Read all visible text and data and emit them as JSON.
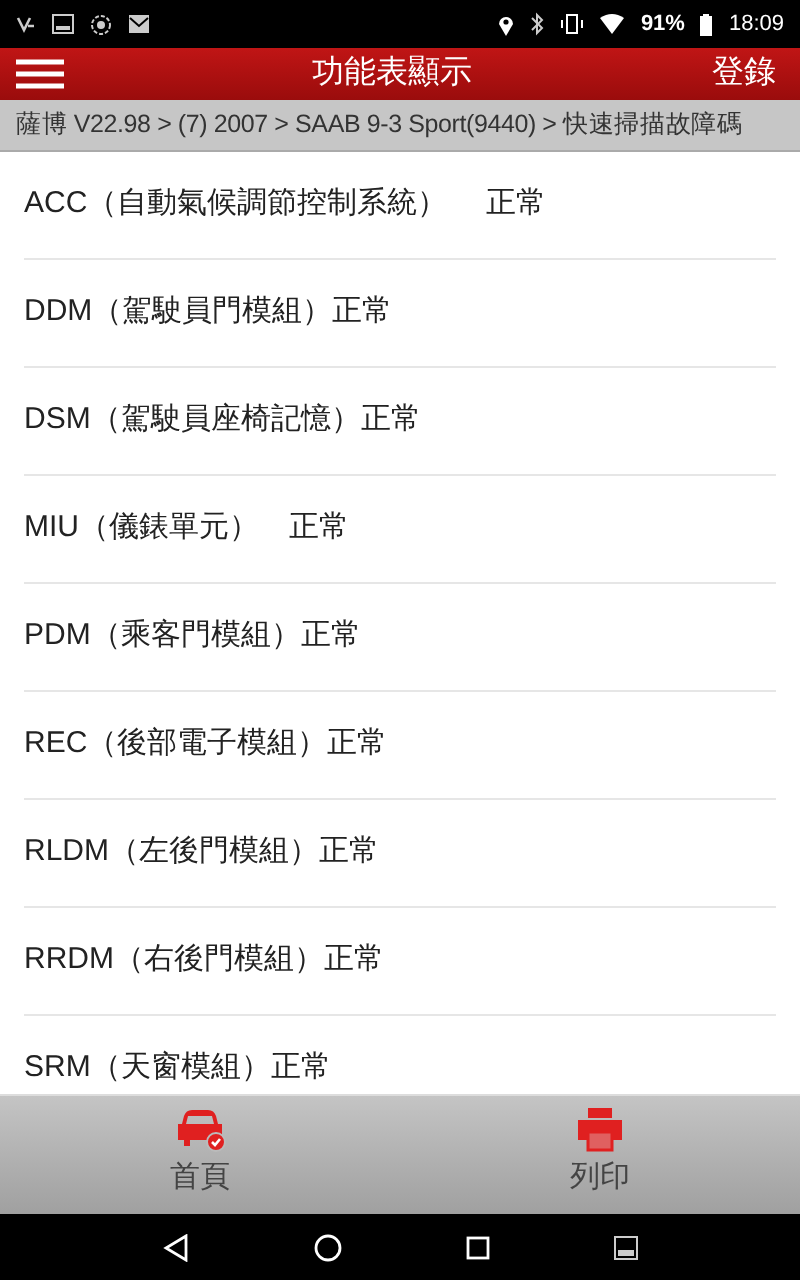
{
  "status_bar": {
    "battery": "91%",
    "time": "18:09"
  },
  "header": {
    "title": "功能表顯示",
    "action": "登錄"
  },
  "breadcrumb": "薩博 V22.98 > (7) 2007 > SAAB 9-3 Sport(9440) > 快速掃描故障碼",
  "rows": [
    {
      "text": "ACC（自動氣候調節控制系統）　 正常"
    },
    {
      "text": "DDM（駕駛員門模組）正常"
    },
    {
      "text": "DSM（駕駛員座椅記憶）正常"
    },
    {
      "text": "MIU（儀錶單元）　正常"
    },
    {
      "text": "PDM（乘客門模組）正常"
    },
    {
      "text": "REC（後部電子模組）正常"
    },
    {
      "text": "RLDM（左後門模組）正常"
    },
    {
      "text": "RRDM（右後門模組）正常"
    },
    {
      "text": "SRM（天窗模組）正常"
    }
  ],
  "bottom_bar": [
    {
      "kind": "home",
      "label": "首頁"
    },
    {
      "kind": "print",
      "label": "列印"
    }
  ]
}
